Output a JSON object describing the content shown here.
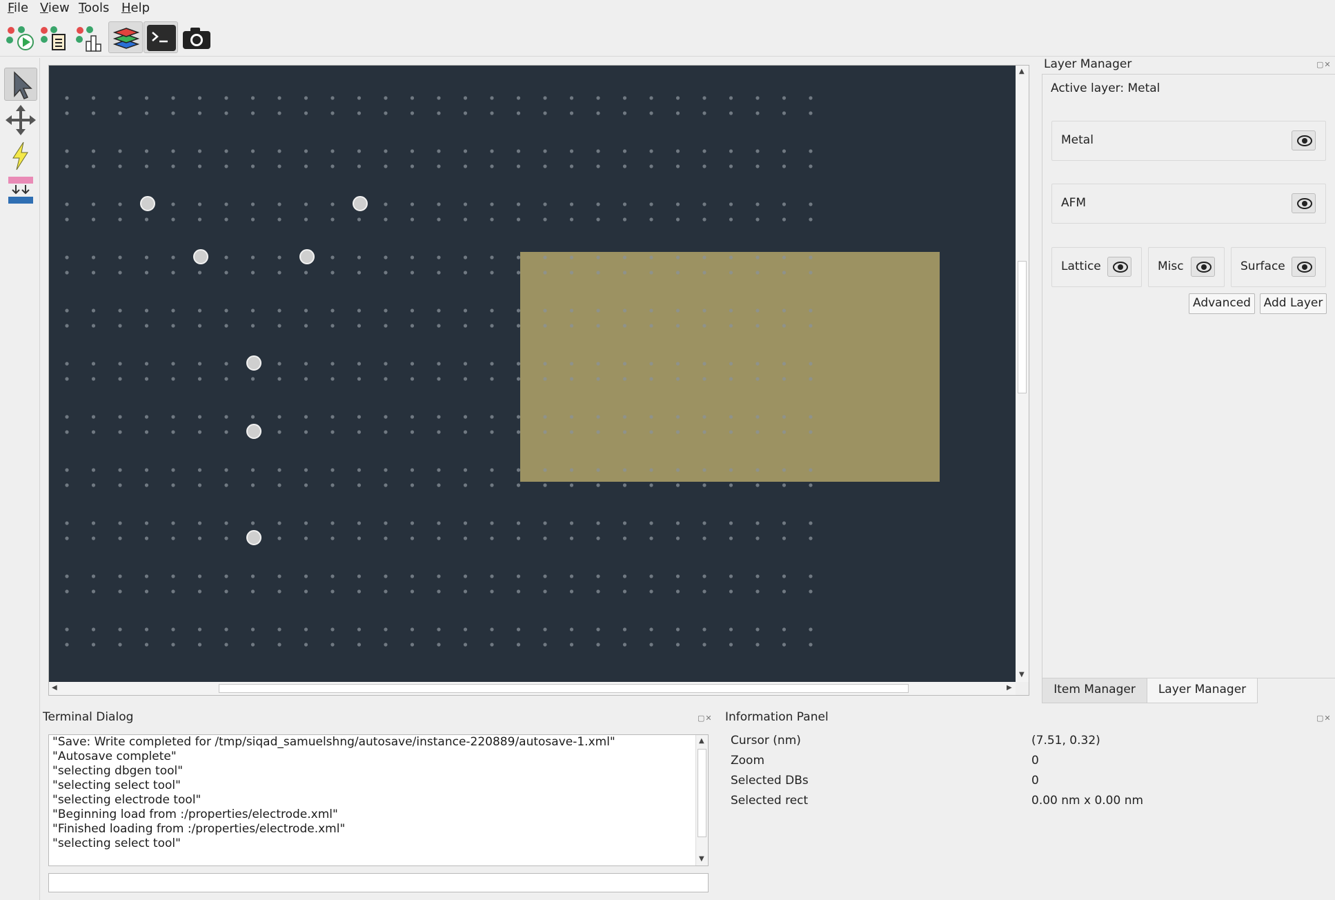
{
  "menu": {
    "file": "File",
    "file_mnemonic": "F",
    "file_rest": "ile",
    "view": "View",
    "view_mnemonic": "V",
    "view_rest": "iew",
    "tools": "Tools",
    "tools_mnemonic": "T",
    "tools_rest": "ools",
    "help": "Help",
    "help_mnemonic": "H",
    "help_rest": "elp"
  },
  "toolbar": {
    "buttons": [
      {
        "icon": "run-simulation-icon",
        "active": false
      },
      {
        "icon": "simulation-script-icon",
        "active": false
      },
      {
        "icon": "simulation-results-icon",
        "active": false
      },
      {
        "icon": "layers-icon",
        "active": true
      },
      {
        "icon": "terminal-icon",
        "active": true
      },
      {
        "icon": "screenshot-camera-icon",
        "active": false
      }
    ]
  },
  "tools": [
    {
      "icon": "select-arrow-icon",
      "active": true
    },
    {
      "icon": "drag-move-icon",
      "active": false
    },
    {
      "icon": "electrode-lightning-icon",
      "active": false
    },
    {
      "icon": "merge-layers-icon",
      "active": false
    }
  ],
  "canvas": {
    "background": "#27313c",
    "lattice_dot_color": "#8a919a",
    "db_color": "#cfcfcf",
    "electrode_color": "#9c9262"
  },
  "layer_manager": {
    "title": "Layer Manager",
    "active_layer_text": "Active layer: Metal",
    "layers": [
      {
        "name": "Metal"
      },
      {
        "name": "AFM"
      },
      {
        "name": "Lattice"
      },
      {
        "name": "Misc"
      },
      {
        "name": "Surface"
      }
    ],
    "advanced_label": "Advanced",
    "add_layer_label": "Add Layer",
    "tabs": [
      "Item Manager",
      "Layer Manager"
    ]
  },
  "terminal": {
    "title": "Terminal Dialog",
    "lines": [
      "\"Save: Write completed for /tmp/siqad_samuelshng/autosave/instance-220889/autosave-1.xml\"",
      "\"Autosave complete\"",
      "\"selecting dbgen tool\"",
      "\"selecting select tool\"",
      "\"selecting electrode tool\"",
      "\"Beginning load from :/properties/electrode.xml\"",
      "\"Finished loading from :/properties/electrode.xml\"",
      "\"selecting select tool\""
    ],
    "input_value": ""
  },
  "info_panel": {
    "title": "Information Panel",
    "rows": [
      {
        "key": "Cursor (nm)",
        "value": "(7.51, 0.32)"
      },
      {
        "key": "Zoom",
        "value": "0"
      },
      {
        "key": "Selected DBs",
        "value": "0"
      },
      {
        "key": "Selected rect",
        "value": "0.00 nm x 0.00 nm"
      }
    ]
  }
}
